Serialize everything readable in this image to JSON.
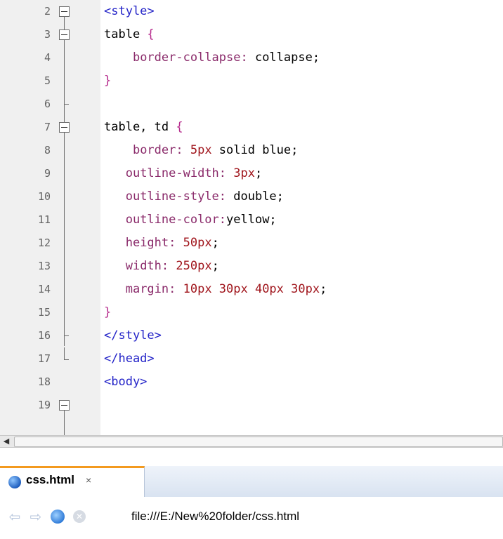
{
  "editor": {
    "lines": [
      {
        "num": "2",
        "text": "<style>"
      },
      {
        "num": "3",
        "text": "table {"
      },
      {
        "num": "4",
        "text": "    border-collapse: collapse;"
      },
      {
        "num": "5",
        "text": "}"
      },
      {
        "num": "6",
        "text": ""
      },
      {
        "num": "7",
        "text": "table, td {"
      },
      {
        "num": "8",
        "text": "    border: 5px solid blue;"
      },
      {
        "num": "9",
        "text": "   outline-width: 3px;"
      },
      {
        "num": "10",
        "text": "   outline-style: double;"
      },
      {
        "num": "11",
        "text": "   outline-color:yellow;"
      },
      {
        "num": "12",
        "text": "   height: 50px;"
      },
      {
        "num": "13",
        "text": "   width: 250px;"
      },
      {
        "num": "14",
        "text": "   margin: 10px 30px 40px 30px;"
      },
      {
        "num": "15",
        "text": "}"
      },
      {
        "num": "16",
        "text": "</style>"
      },
      {
        "num": "17",
        "text": "</head>"
      },
      {
        "num": "18",
        "text": "<body>"
      },
      {
        "num": "19",
        "text": ""
      }
    ]
  },
  "tab": {
    "label": "css.html",
    "close": "×"
  },
  "nav": {
    "url": "file:///E:/New%20folder/css.html"
  },
  "colors": {
    "tag": "#2424c8",
    "property": "#8a2a6a",
    "number": "#a0151c",
    "tab_accent": "#f39a1f"
  }
}
